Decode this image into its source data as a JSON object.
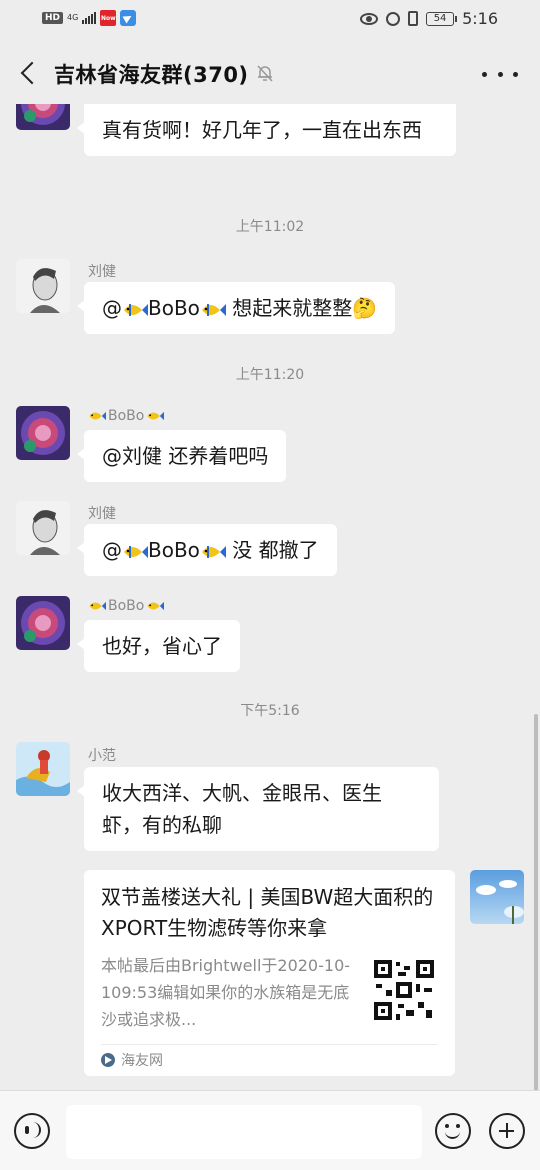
{
  "status_bar": {
    "hd": "HD",
    "network": "4G",
    "app_badge": "Now",
    "battery": "54",
    "time": "5:16",
    "icons": [
      "eye-icon",
      "alarm-icon",
      "vibrate-icon",
      "battery-icon"
    ]
  },
  "header": {
    "title": "吉林省海友群(370)",
    "icons": [
      "back-icon",
      "mute-bell-icon",
      "more-icon"
    ]
  },
  "colors": {
    "background": "#ededed",
    "bubble": "#ffffff",
    "muted_text": "#8a8a8a"
  },
  "chat": {
    "m0_text": "真有货啊！好几年了，一直在出东西",
    "t1": "上午11:02",
    "m1_sender": "刘健",
    "m1_at": "@",
    "m1_name": "BoBo",
    "m1_text": " 想起来就整整🤔",
    "t2": "上午11:20",
    "m2_sender": "BoBo",
    "m2_text": "@刘健  还养着吧吗",
    "m3_sender": "刘健",
    "m3_at": "@",
    "m3_name": "BoBo",
    "m3_text": " 没 都撤了",
    "m4_sender": "BoBo",
    "m4_text": "也好，省心了",
    "t3": "下午5:16",
    "m5_sender": "小范",
    "m5_text": "收大西洋、大帆、金眼吊、医生虾，有的私聊",
    "card": {
      "title": "双节盖楼送大礼 | 美国BW超大面积的XPORT生物滤砖等你来拿",
      "desc": "本帖最后由Brightwell于2020-10-109:53编辑如果你的水族箱是无底沙或追求极...",
      "source": "海友网"
    }
  },
  "input_bar": {
    "placeholder": "",
    "icons": [
      "voice-icon",
      "emoji-icon",
      "plus-icon"
    ]
  }
}
